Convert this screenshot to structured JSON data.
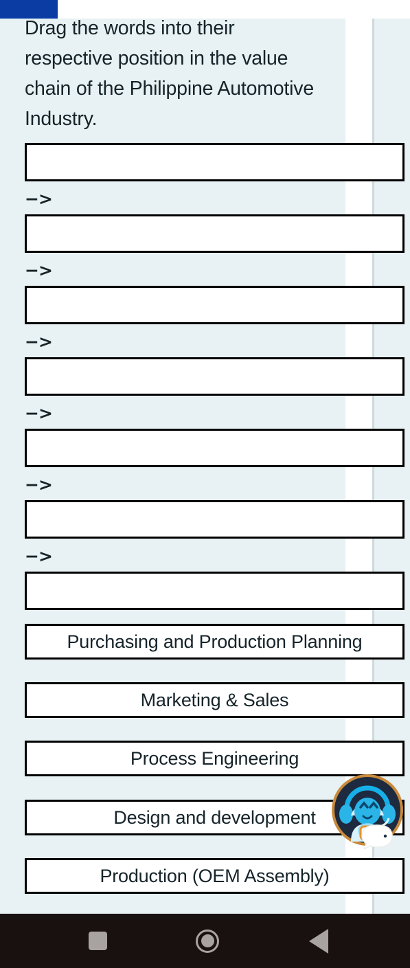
{
  "statusbar": {
    "tab_color": "#0a3ca4",
    "background": "#ffffff"
  },
  "theme": {
    "page_background": "#e8f1f3",
    "text_color": "#16242a",
    "box_border": "#000000",
    "box_fill": "#ffffff",
    "accent_blue": "#0a3ca4",
    "navbar_background": "#191110",
    "navbar_icon": "#a8a3a0"
  },
  "exercise": {
    "prompt": "Drag the words into their respective position in the value chain of the Philippine Automotive Industry.",
    "arrow_symbol": "−>",
    "drop_slots": [
      {
        "index": 1,
        "value": "",
        "placeholder": ""
      },
      {
        "index": 2,
        "value": "",
        "placeholder": ""
      },
      {
        "index": 3,
        "value": "",
        "placeholder": ""
      },
      {
        "index": 4,
        "value": "",
        "placeholder": ""
      },
      {
        "index": 5,
        "value": "",
        "placeholder": ""
      },
      {
        "index": 6,
        "value": "",
        "placeholder": ""
      },
      {
        "index": 7,
        "value": "",
        "placeholder": ""
      }
    ],
    "word_bank": [
      {
        "index": 1,
        "label": "Purchasing and Production Planning"
      },
      {
        "index": 2,
        "label": "Marketing & Sales"
      },
      {
        "index": 3,
        "label": "Process Engineering"
      },
      {
        "index": 4,
        "label": "Design and development"
      },
      {
        "index": 5,
        "label": "Production (OEM Assembly)"
      }
    ]
  },
  "chatbot": {
    "name": "chatbot-avatar",
    "icon": "robot-headset-icon",
    "ring_color": "#c98a3c",
    "body_color": "#2ab4e8",
    "circle_color": "#1d2a3f"
  },
  "navbar": {
    "buttons": [
      {
        "name": "recents",
        "icon": "square-icon"
      },
      {
        "name": "home",
        "icon": "circle-icon"
      },
      {
        "name": "back",
        "icon": "triangle-left-icon"
      }
    ]
  }
}
